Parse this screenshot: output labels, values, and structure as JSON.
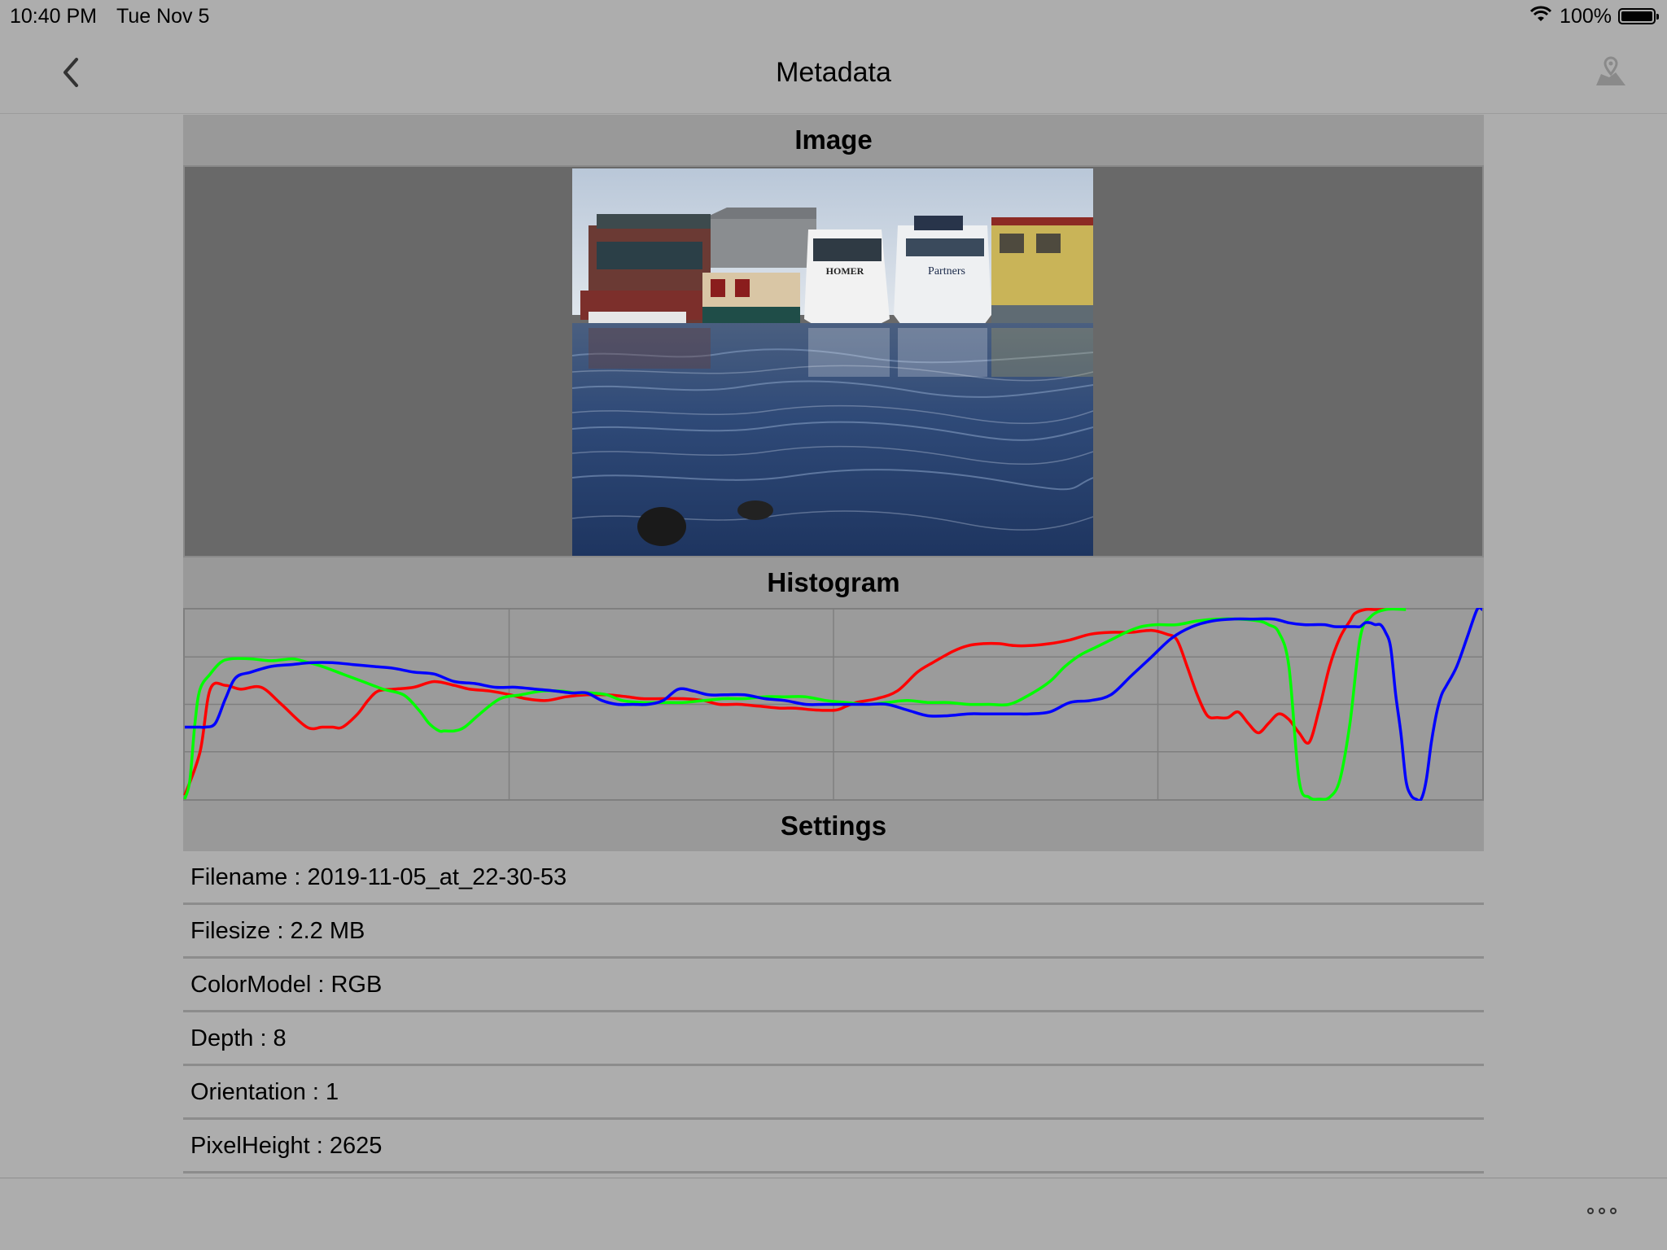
{
  "status_bar": {
    "time": "10:40 PM",
    "date": "Tue Nov 5",
    "battery": "100%",
    "icons": [
      "wifi-icon",
      "battery-icon"
    ]
  },
  "nav": {
    "title": "Metadata",
    "back_icon": "chevron-left-icon",
    "map_icon": "map-pin-icon"
  },
  "sections": {
    "image": "Image",
    "histogram": "Histogram",
    "settings": "Settings"
  },
  "photo": {
    "boat_labels": [
      "HOMER",
      "Partners"
    ]
  },
  "chart_data": {
    "type": "line",
    "xlim": [
      0,
      255
    ],
    "ylim": [
      0,
      1
    ],
    "grid": true,
    "grid_divisions": {
      "x": 4,
      "y": 4
    },
    "series": [
      {
        "color": "#ff0000",
        "x": [
          0,
          3,
          5,
          8,
          11,
          15,
          19,
          24,
          27,
          29,
          31,
          34,
          36,
          38,
          41,
          45,
          49,
          53,
          56,
          60,
          64,
          67,
          71,
          75,
          79,
          83,
          87,
          90,
          94,
          98,
          102,
          105,
          109,
          113,
          117,
          120,
          124,
          128,
          130,
          132,
          136,
          140,
          144,
          147,
          151,
          154,
          157,
          160,
          163,
          166,
          170,
          174,
          178,
          182,
          186,
          190,
          193,
          195,
          197,
          199,
          201,
          203,
          205,
          207,
          209,
          211,
          213,
          215,
          217,
          219,
          221,
          223,
          225,
          227,
          229,
          230,
          232,
          234,
          236
        ],
        "y": [
          0.02,
          0.25,
          0.58,
          0.6,
          0.58,
          0.59,
          0.5,
          0.38,
          0.38,
          0.38,
          0.38,
          0.45,
          0.52,
          0.57,
          0.58,
          0.59,
          0.62,
          0.6,
          0.58,
          0.57,
          0.55,
          0.53,
          0.52,
          0.54,
          0.55,
          0.55,
          0.54,
          0.53,
          0.53,
          0.53,
          0.52,
          0.5,
          0.5,
          0.49,
          0.48,
          0.48,
          0.47,
          0.47,
          0.49,
          0.51,
          0.53,
          0.57,
          0.67,
          0.72,
          0.78,
          0.81,
          0.82,
          0.82,
          0.81,
          0.81,
          0.82,
          0.84,
          0.87,
          0.88,
          0.88,
          0.89,
          0.87,
          0.84,
          0.7,
          0.55,
          0.44,
          0.43,
          0.43,
          0.46,
          0.4,
          0.35,
          0.4,
          0.45,
          0.42,
          0.35,
          0.3,
          0.48,
          0.7,
          0.85,
          0.94,
          0.98,
          1.0,
          1.0,
          1.0
        ]
      },
      {
        "color": "#00ff00",
        "x": [
          0,
          1,
          2,
          3,
          5,
          7,
          9,
          13,
          17,
          21,
          23,
          27,
          31,
          35,
          39,
          43,
          46,
          48,
          50,
          51,
          53,
          55,
          58,
          62,
          66,
          70,
          74,
          77,
          80,
          83,
          86,
          90,
          94,
          98,
          102,
          106,
          110,
          114,
          118,
          122,
          126,
          130,
          134,
          138,
          142,
          146,
          150,
          154,
          158,
          162,
          166,
          170,
          173,
          176,
          179,
          182,
          185,
          188,
          191,
          195,
          199,
          203,
          207,
          211,
          213,
          215,
          217,
          219,
          221,
          223,
          225,
          227,
          229,
          231,
          233,
          236,
          240
        ],
        "y": [
          0,
          0.1,
          0.4,
          0.58,
          0.66,
          0.72,
          0.74,
          0.74,
          0.73,
          0.74,
          0.73,
          0.7,
          0.66,
          0.62,
          0.58,
          0.55,
          0.47,
          0.4,
          0.36,
          0.36,
          0.36,
          0.38,
          0.45,
          0.53,
          0.55,
          0.57,
          0.57,
          0.56,
          0.56,
          0.55,
          0.52,
          0.51,
          0.51,
          0.51,
          0.52,
          0.53,
          0.53,
          0.54,
          0.54,
          0.54,
          0.52,
          0.51,
          0.5,
          0.51,
          0.52,
          0.51,
          0.51,
          0.5,
          0.5,
          0.5,
          0.55,
          0.62,
          0.7,
          0.76,
          0.8,
          0.84,
          0.88,
          0.91,
          0.92,
          0.92,
          0.94,
          0.95,
          0.95,
          0.94,
          0.92,
          0.88,
          0.7,
          0.1,
          0.01,
          0.0,
          0.01,
          0.1,
          0.4,
          0.85,
          0.96,
          1.0,
          1.0
        ]
      },
      {
        "color": "#0000ff",
        "x": [
          0,
          3,
          4,
          6,
          8,
          10,
          13,
          17,
          21,
          25,
          29,
          33,
          37,
          41,
          45,
          49,
          53,
          57,
          61,
          65,
          69,
          73,
          76,
          79,
          82,
          85,
          88,
          91,
          94,
          97,
          100,
          103,
          106,
          110,
          114,
          118,
          122,
          126,
          130,
          134,
          138,
          142,
          146,
          150,
          154,
          157,
          160,
          163,
          166,
          170,
          174,
          178,
          182,
          186,
          190,
          194,
          198,
          202,
          206,
          210,
          214,
          217,
          220,
          222,
          224,
          226,
          228,
          230,
          231,
          232,
          233,
          234,
          235,
          236,
          237,
          238,
          239,
          240,
          241,
          242,
          243,
          244,
          245,
          246,
          247,
          248,
          250,
          252,
          254,
          255
        ],
        "y": [
          0.38,
          0.38,
          0.38,
          0.4,
          0.53,
          0.64,
          0.67,
          0.7,
          0.71,
          0.72,
          0.72,
          0.71,
          0.7,
          0.69,
          0.67,
          0.66,
          0.62,
          0.61,
          0.59,
          0.59,
          0.58,
          0.57,
          0.56,
          0.56,
          0.52,
          0.5,
          0.5,
          0.5,
          0.52,
          0.58,
          0.57,
          0.55,
          0.55,
          0.55,
          0.53,
          0.52,
          0.5,
          0.5,
          0.5,
          0.5,
          0.5,
          0.47,
          0.44,
          0.44,
          0.45,
          0.45,
          0.45,
          0.45,
          0.45,
          0.46,
          0.51,
          0.52,
          0.55,
          0.65,
          0.75,
          0.85,
          0.91,
          0.94,
          0.95,
          0.95,
          0.95,
          0.93,
          0.92,
          0.92,
          0.92,
          0.91,
          0.91,
          0.91,
          0.91,
          0.93,
          0.93,
          0.92,
          0.92,
          0.88,
          0.8,
          0.55,
          0.35,
          0.1,
          0.02,
          0.0,
          0.0,
          0.1,
          0.3,
          0.45,
          0.55,
          0.6,
          0.7,
          0.85,
          1.0,
          1.0
        ]
      }
    ]
  },
  "settings": [
    {
      "label": "Filename : 2019-11-05_at_22-30-53"
    },
    {
      "label": "Filesize : 2.2 MB"
    },
    {
      "label": "ColorModel : RGB"
    },
    {
      "label": "Depth : 8"
    },
    {
      "label": "Orientation : 1"
    },
    {
      "label": "PixelHeight : 2625"
    }
  ],
  "toolbar": {
    "more_icon": "more-options-icon"
  }
}
